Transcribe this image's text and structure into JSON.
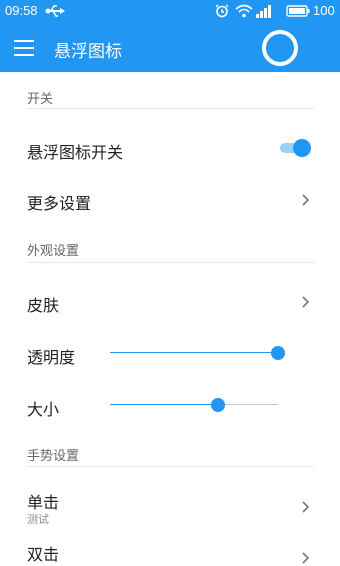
{
  "status_bar": {
    "time": "09:58",
    "battery": "100",
    "icons": [
      "usb-icon",
      "alarm-icon",
      "wifi-icon",
      "signal-icon",
      "battery-icon"
    ]
  },
  "app_bar": {
    "title": "悬浮图标",
    "color": "#2196f3"
  },
  "sections": {
    "switch": "开关",
    "appearance": "外观设置",
    "gesture": "手势设置"
  },
  "rows": {
    "float_switch": {
      "label": "悬浮图标开关",
      "on": true
    },
    "more_settings": {
      "label": "更多设置"
    },
    "skin": {
      "label": "皮肤"
    },
    "transparency": {
      "label": "透明度",
      "value": 1.0
    },
    "size": {
      "label": "大小",
      "value": 0.64
    },
    "single_tap": {
      "label": "单击",
      "sub": "测试"
    },
    "double_tap": {
      "label": "双击"
    }
  }
}
